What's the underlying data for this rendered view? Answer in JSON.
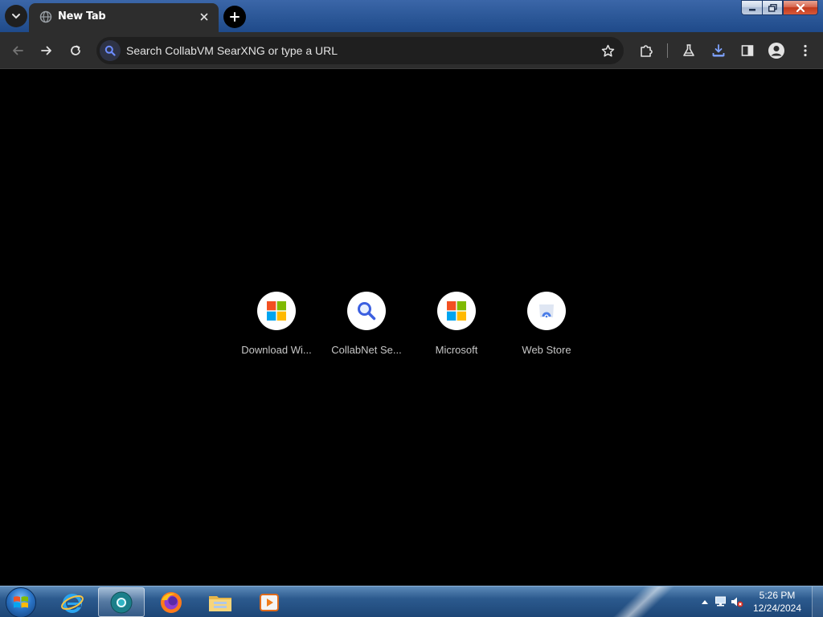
{
  "window": {
    "tab": {
      "title": "New Tab",
      "favicon": "globe-icon"
    },
    "controls": [
      "minimize-icon",
      "maximize-icon",
      "close-icon"
    ]
  },
  "toolbar": {
    "omnibox_placeholder": "Search CollabVM SearXNG or type a URL",
    "icons": [
      "back-arrow-icon",
      "forward-arrow-icon",
      "reload-icon",
      "bookmark-star-icon",
      "extensions-icon",
      "labs-flask-icon",
      "download-icon",
      "side-panel-icon",
      "profile-icon",
      "menu-kebab-icon"
    ]
  },
  "shortcuts": [
    {
      "label": "Download Wi...",
      "icon": "microsoft-logo-icon"
    },
    {
      "label": "CollabNet Se...",
      "icon": "search-magnifier-icon"
    },
    {
      "label": "Microsoft",
      "icon": "microsoft-logo-icon"
    },
    {
      "label": "Web Store",
      "icon": "web-store-icon"
    }
  ],
  "taskbar": {
    "apps": [
      "internet-explorer-icon",
      "chrome-icon",
      "firefox-icon",
      "file-explorer-icon",
      "media-player-icon"
    ],
    "active_app": "chrome-icon",
    "clock": {
      "time": "5:26 PM",
      "date": "12/24/2024"
    }
  },
  "colors": {
    "tab_bg": "#2d2d2d",
    "toolbar_bg": "#2d2d2d",
    "omnibox_bg": "#1f1f1f",
    "content_bg": "#000000",
    "shortcut_label": "#c6c6c6",
    "accent_blue": "#1a73e8"
  }
}
